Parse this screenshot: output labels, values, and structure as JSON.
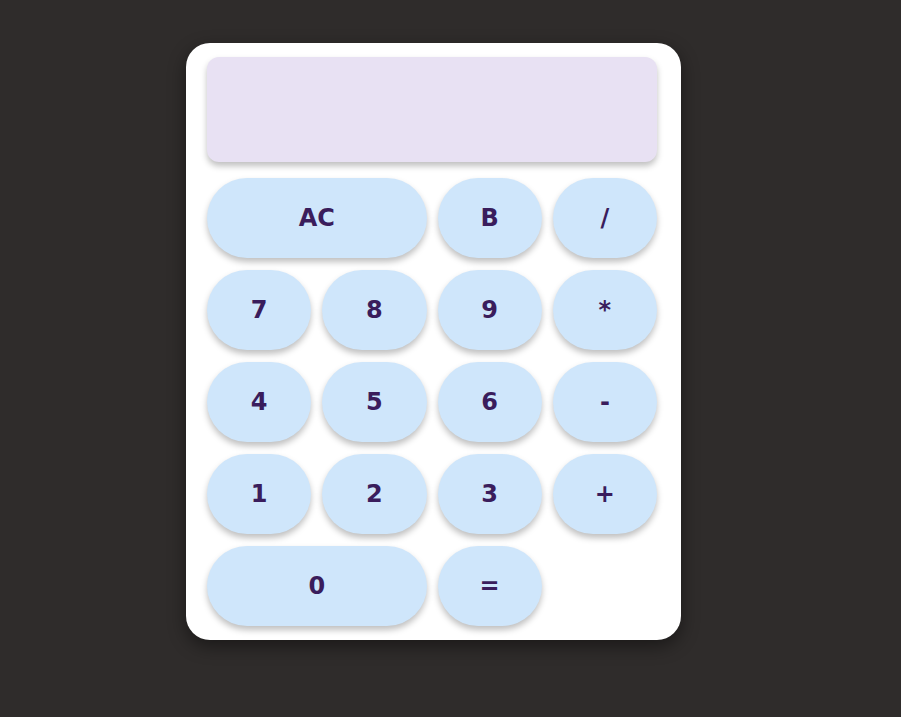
{
  "display": {
    "value": ""
  },
  "keys": [
    {
      "label": "AC",
      "kind": "wide"
    },
    {
      "label": "B",
      "kind": "key"
    },
    {
      "label": "/",
      "kind": "key"
    },
    {
      "label": "7",
      "kind": "key"
    },
    {
      "label": "8",
      "kind": "key"
    },
    {
      "label": "9",
      "kind": "key"
    },
    {
      "label": "*",
      "kind": "key"
    },
    {
      "label": "4",
      "kind": "key"
    },
    {
      "label": "5",
      "kind": "key"
    },
    {
      "label": "6",
      "kind": "key"
    },
    {
      "label": "-",
      "kind": "key"
    },
    {
      "label": "1",
      "kind": "key"
    },
    {
      "label": "2",
      "kind": "key"
    },
    {
      "label": "3",
      "kind": "key"
    },
    {
      "label": "+",
      "kind": "key"
    },
    {
      "label": "0",
      "kind": "wide"
    },
    {
      "label": "=",
      "kind": "key"
    }
  ]
}
